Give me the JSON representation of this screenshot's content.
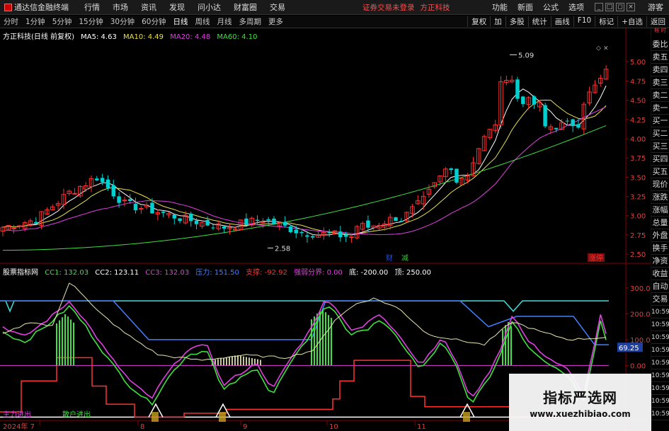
{
  "menubar": {
    "app_title": "通达信金融终端",
    "items": [
      "行情",
      "市场",
      "资讯",
      "发现",
      "问小达",
      "财富圈",
      "交易"
    ],
    "login_note": "证券交易未登录",
    "brand": "方正科技",
    "right_items": [
      "功能",
      "新面",
      "公式",
      "选项"
    ],
    "guest": "游客"
  },
  "toolbar": {
    "periods": [
      "分时",
      "1分钟",
      "5分钟",
      "15分钟",
      "30分钟",
      "60分钟",
      "日线",
      "周线",
      "月线",
      "多周期",
      "更多"
    ],
    "active_period": "日线",
    "tools": [
      "复权",
      "加",
      "多股",
      "统计",
      "画线",
      "F10",
      "标记",
      "+自选",
      "返回"
    ]
  },
  "sidebar": {
    "top": "帐 时",
    "items": [
      "委比",
      "卖五",
      "卖四",
      "卖三",
      "卖二",
      "卖一",
      "买一",
      "买二",
      "买三",
      "买四",
      "买五",
      "现价",
      "涨跌",
      "涨幅",
      "总量",
      "外盘",
      "换手",
      "净资",
      "收益",
      "自动",
      "交易",
      "10:59",
      "10:59",
      "10:59",
      "10:59",
      "10:59",
      "10:59",
      "10:59",
      "10:59",
      "10:59"
    ]
  },
  "price_panel": {
    "title": "方正科技(日线 前复权)",
    "ma": [
      {
        "label": "MA5: 4.63",
        "color": "#ffffff"
      },
      {
        "label": "MA10: 4.49",
        "color": "#e8e050"
      },
      {
        "label": "MA20: 4.48",
        "color": "#e040e0"
      },
      {
        "label": "MA60: 4.10",
        "color": "#40e040"
      }
    ],
    "high_label": "5.09",
    "low_label": "2.58",
    "axis_labels": [
      "5.00",
      "4.75",
      "4.50",
      "4.25",
      "4.00",
      "3.75",
      "3.50",
      "3.25",
      "3.00",
      "2.75",
      "2.50"
    ],
    "markers": [
      "财",
      "减",
      "涨停"
    ],
    "colors": {
      "up": "#ff3030",
      "down": "#00d0d0"
    }
  },
  "indicator_panel": {
    "name": "股票指标网",
    "items": [
      {
        "label": "CC1: 132.03",
        "color": "#40e040"
      },
      {
        "label": "CC2: 123.11",
        "color": "#ffffff"
      },
      {
        "label": "CC3: 132.03",
        "color": "#e040e0"
      },
      {
        "label": "压力: 151.50",
        "color": "#4080ff"
      },
      {
        "label": "支撑: -92.92",
        "color": "#ff3030"
      },
      {
        "label": "强弱分界: 0.00",
        "color": "#e040e0"
      },
      {
        "label": "底: -200.00",
        "color": "#ffffff"
      },
      {
        "label": "顶: 250.00",
        "color": "#ffffff"
      }
    ],
    "axis_labels": [
      "300.0",
      "200.0",
      "100.0",
      "0.00"
    ],
    "current_value": "69.25",
    "annotations": [
      "主力进出",
      "散户进出"
    ]
  },
  "date_axis": [
    "2024年 7",
    "8",
    "9",
    "10",
    "11"
  ],
  "watermark": {
    "line1": "指标严选网",
    "line2": "www.xuezhibiao.com"
  }
}
